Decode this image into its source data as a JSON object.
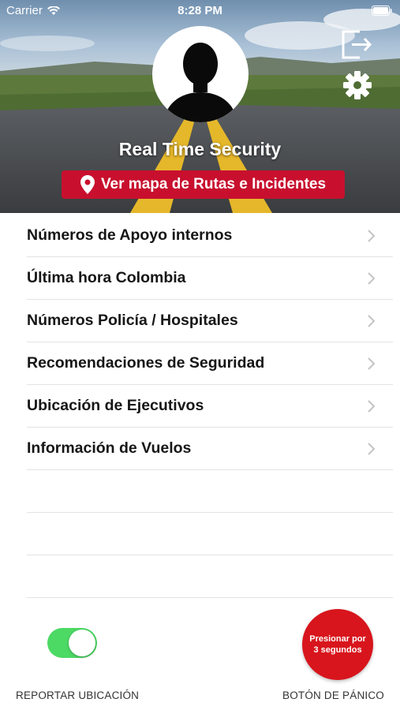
{
  "status_bar": {
    "carrier": "Carrier",
    "time": "8:28 PM"
  },
  "header": {
    "title": "Real Time Security",
    "map_button_label": "Ver mapa de Rutas e Incidentes",
    "avatar_icon": "person-silhouette-icon",
    "logout_icon": "logout-icon",
    "settings_icon": "gear-icon"
  },
  "menu": {
    "items": [
      {
        "label": "Números de Apoyo internos"
      },
      {
        "label": "Última hora Colombia"
      },
      {
        "label": "Números Policía / Hospitales"
      },
      {
        "label": "Recomendaciones de Seguridad"
      },
      {
        "label": "Ubicación de Ejecutivos"
      },
      {
        "label": "Información de Vuelos"
      }
    ]
  },
  "bottom": {
    "report_location_label": "REPORTAR UBICACIÓN",
    "report_location_enabled": true,
    "panic_button_text": "Presionar por 3 segundos",
    "panic_label": "BOTÓN DE PÁNICO"
  },
  "colors": {
    "accent_red": "#c8102e",
    "toggle_on": "#4cd964",
    "panic_red": "#d8151c"
  }
}
